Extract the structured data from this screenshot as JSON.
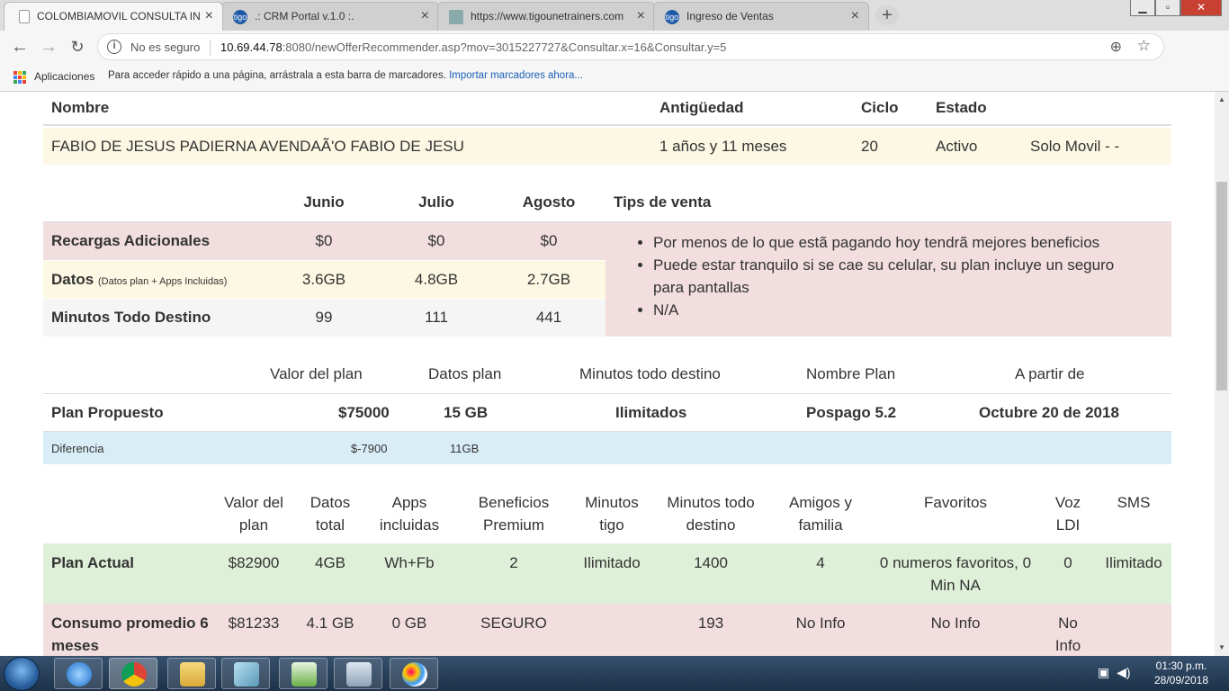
{
  "browser": {
    "tabs": [
      {
        "label": "COLOMBIAMOVIL CONSULTA IN",
        "icon": "document-icon",
        "active": true
      },
      {
        "label": ".: CRM Portal v.1.0 :.",
        "icon": "tigo-icon",
        "active": false
      },
      {
        "label": "https://www.tigounetrainers.com",
        "icon": "site-icon",
        "active": false
      },
      {
        "label": "Ingreso de Ventas",
        "icon": "tigo-icon",
        "active": false
      }
    ],
    "security_label": "No es seguro",
    "url_host": "10.69.44.78",
    "url_rest": ":8080/newOfferRecommender.asp?mov=3015227727&Consultar.x=16&Consultar.y=5",
    "bookmarks_apps": "Aplicaciones",
    "bookmarks_hint": "Para acceder rápido a una página, arrástrala a esta barra de marcadores.",
    "bookmarks_import": "Importar marcadores ahora..."
  },
  "customer": {
    "headers": {
      "name": "Nombre",
      "age": "Antigüedad",
      "cycle": "Ciclo",
      "state": "Estado"
    },
    "name": "FABIO DE JESUS PADIERNA AVENDAÃ'O FABIO DE JESU",
    "age": "1 años y 11 meses",
    "cycle": "20",
    "state": "Activo",
    "type": "Solo Movil - -"
  },
  "usage": {
    "months": [
      "Junio",
      "Julio",
      "Agosto"
    ],
    "tips_title": "Tips de venta",
    "rows": [
      {
        "label": "Recargas Adicionales",
        "note": "",
        "values": [
          "$0",
          "$0",
          "$0"
        ]
      },
      {
        "label": "Datos",
        "note": "(Datos plan + Apps Incluidas)",
        "values": [
          "3.6GB",
          "4.8GB",
          "2.7GB"
        ]
      },
      {
        "label": "Minutos Todo Destino",
        "note": "",
        "values": [
          "99",
          "111",
          "441"
        ]
      }
    ],
    "tips": [
      "Por menos de lo que estã pagando hoy tendrã mejores beneficios",
      "Puede estar tranquilo si se cae su celular, su plan incluye un seguro para pantallas",
      "N/A"
    ]
  },
  "proposed": {
    "headers": [
      "Valor del plan",
      "Datos plan",
      "Minutos todo destino",
      "Nombre Plan",
      "A partir de"
    ],
    "label": "Plan Propuesto",
    "values": [
      "$75000",
      "15 GB",
      "Ilimitados",
      "Pospago 5.2",
      "Octubre 20 de 2018"
    ],
    "diff_label": "Diferencia",
    "diff_values": [
      "$-7900",
      "11GB"
    ]
  },
  "current": {
    "headers": [
      [
        "Valor del",
        "plan"
      ],
      [
        "Datos",
        "total"
      ],
      [
        "Apps",
        "incluidas"
      ],
      [
        "Beneficios",
        "Premium"
      ],
      [
        "Minutos",
        "tigo"
      ],
      [
        "Minutos todo",
        "destino"
      ],
      [
        "Amigos y",
        "familia"
      ],
      [
        "Favoritos",
        ""
      ],
      [
        "Voz",
        "LDI"
      ],
      [
        "SMS",
        ""
      ]
    ],
    "plan_label": "Plan Actual",
    "plan_values": [
      "$82900",
      "4GB",
      "Wh+Fb",
      "2",
      "Ilimitado",
      "1400",
      "4",
      "0 numeros favoritos, 0 Min NA",
      "0",
      "Ilimitado"
    ],
    "avg_label": "Consumo promedio 6 meses",
    "avg_values": [
      "$81233",
      "4.1 GB",
      "0 GB",
      "SEGURO",
      "",
      "193",
      "No Info",
      "No Info",
      "No Info",
      ""
    ]
  },
  "taskbar": {
    "time": "01:30 p.m.",
    "date": "28/09/2018"
  },
  "colors": {
    "row_yellow": "#fcf8e3",
    "row_red": "#f2dede",
    "row_blue": "#d9edf7",
    "row_green": "#dff0d8",
    "row_gray": "#f5f5f5"
  }
}
